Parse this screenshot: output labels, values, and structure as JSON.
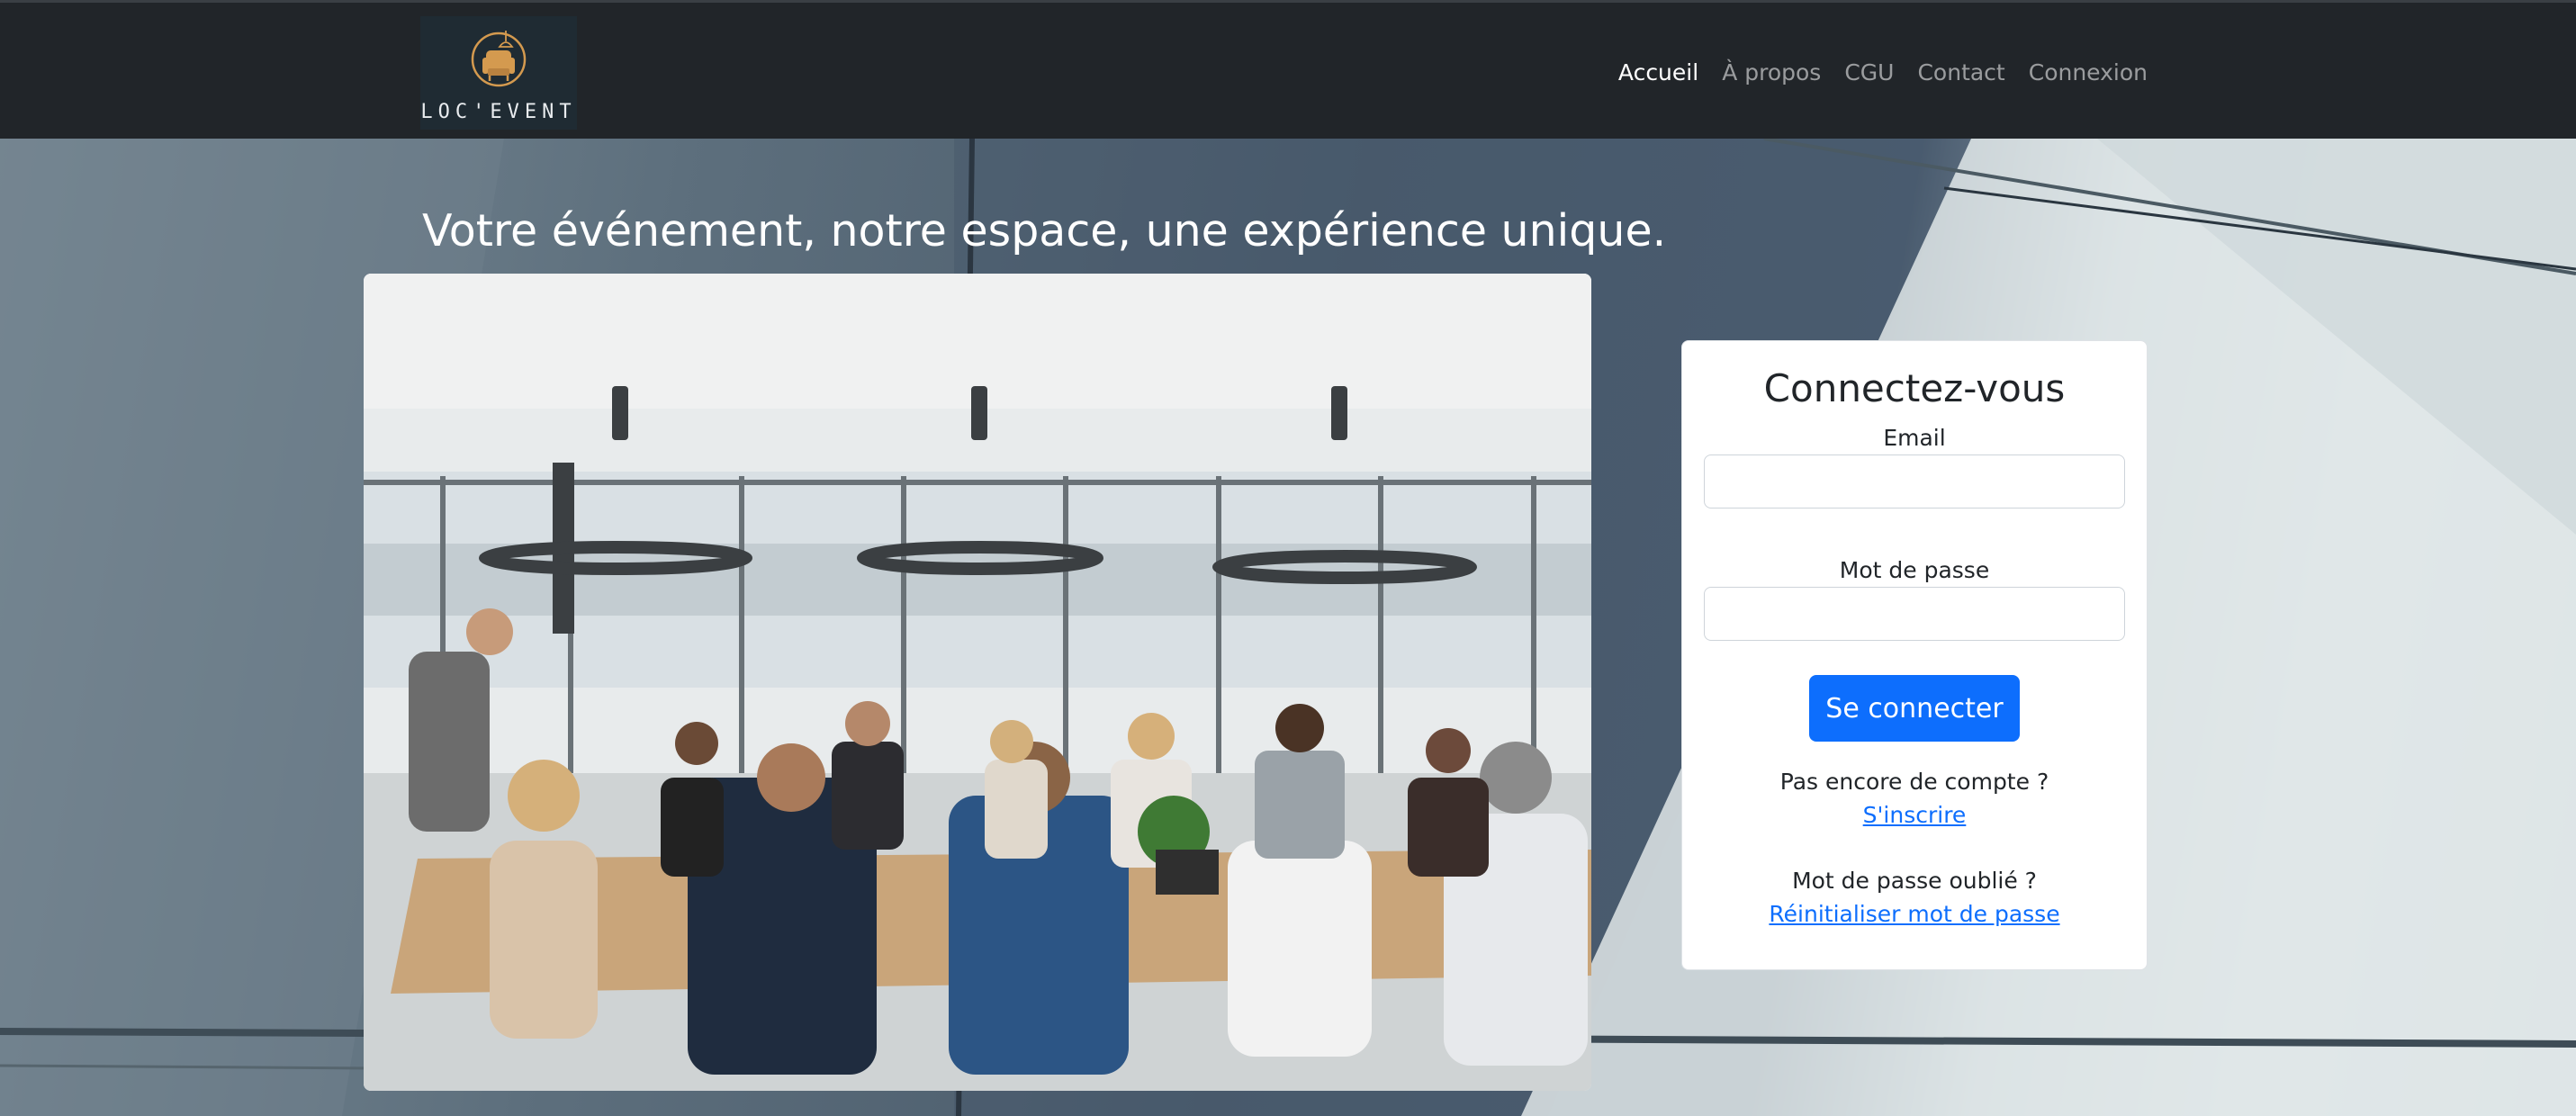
{
  "brand": {
    "logo_text": "LOC'EVENT",
    "colors": {
      "mark": "#d49a4f",
      "background": "#1f2b33"
    }
  },
  "nav": {
    "items": [
      {
        "label": "Accueil",
        "active": true
      },
      {
        "label": "À propos",
        "active": false
      },
      {
        "label": "CGU",
        "active": false
      },
      {
        "label": "Contact",
        "active": false
      },
      {
        "label": "Connexion",
        "active": false
      }
    ]
  },
  "hero": {
    "headline": "Votre événement, notre espace, une expérience unique.",
    "image_alt": "Réunion d'équipe autour d'une grande table de conférence"
  },
  "login": {
    "title": "Connectez-vous",
    "email_label": "Email",
    "email_value": "",
    "password_label": "Mot de passe",
    "password_value": "",
    "submit_label": "Se connecter",
    "no_account_text": "Pas encore de compte ?",
    "signup_link": "S'inscrire",
    "forgot_text": "Mot de passe oublié ?",
    "reset_link": "Réinitialiser mot de passe"
  },
  "colors": {
    "navbar": "#212529",
    "primary": "#0d6efd",
    "nav_active": "#ffffff",
    "nav_inactive": "rgba(255,255,255,0.55)"
  }
}
